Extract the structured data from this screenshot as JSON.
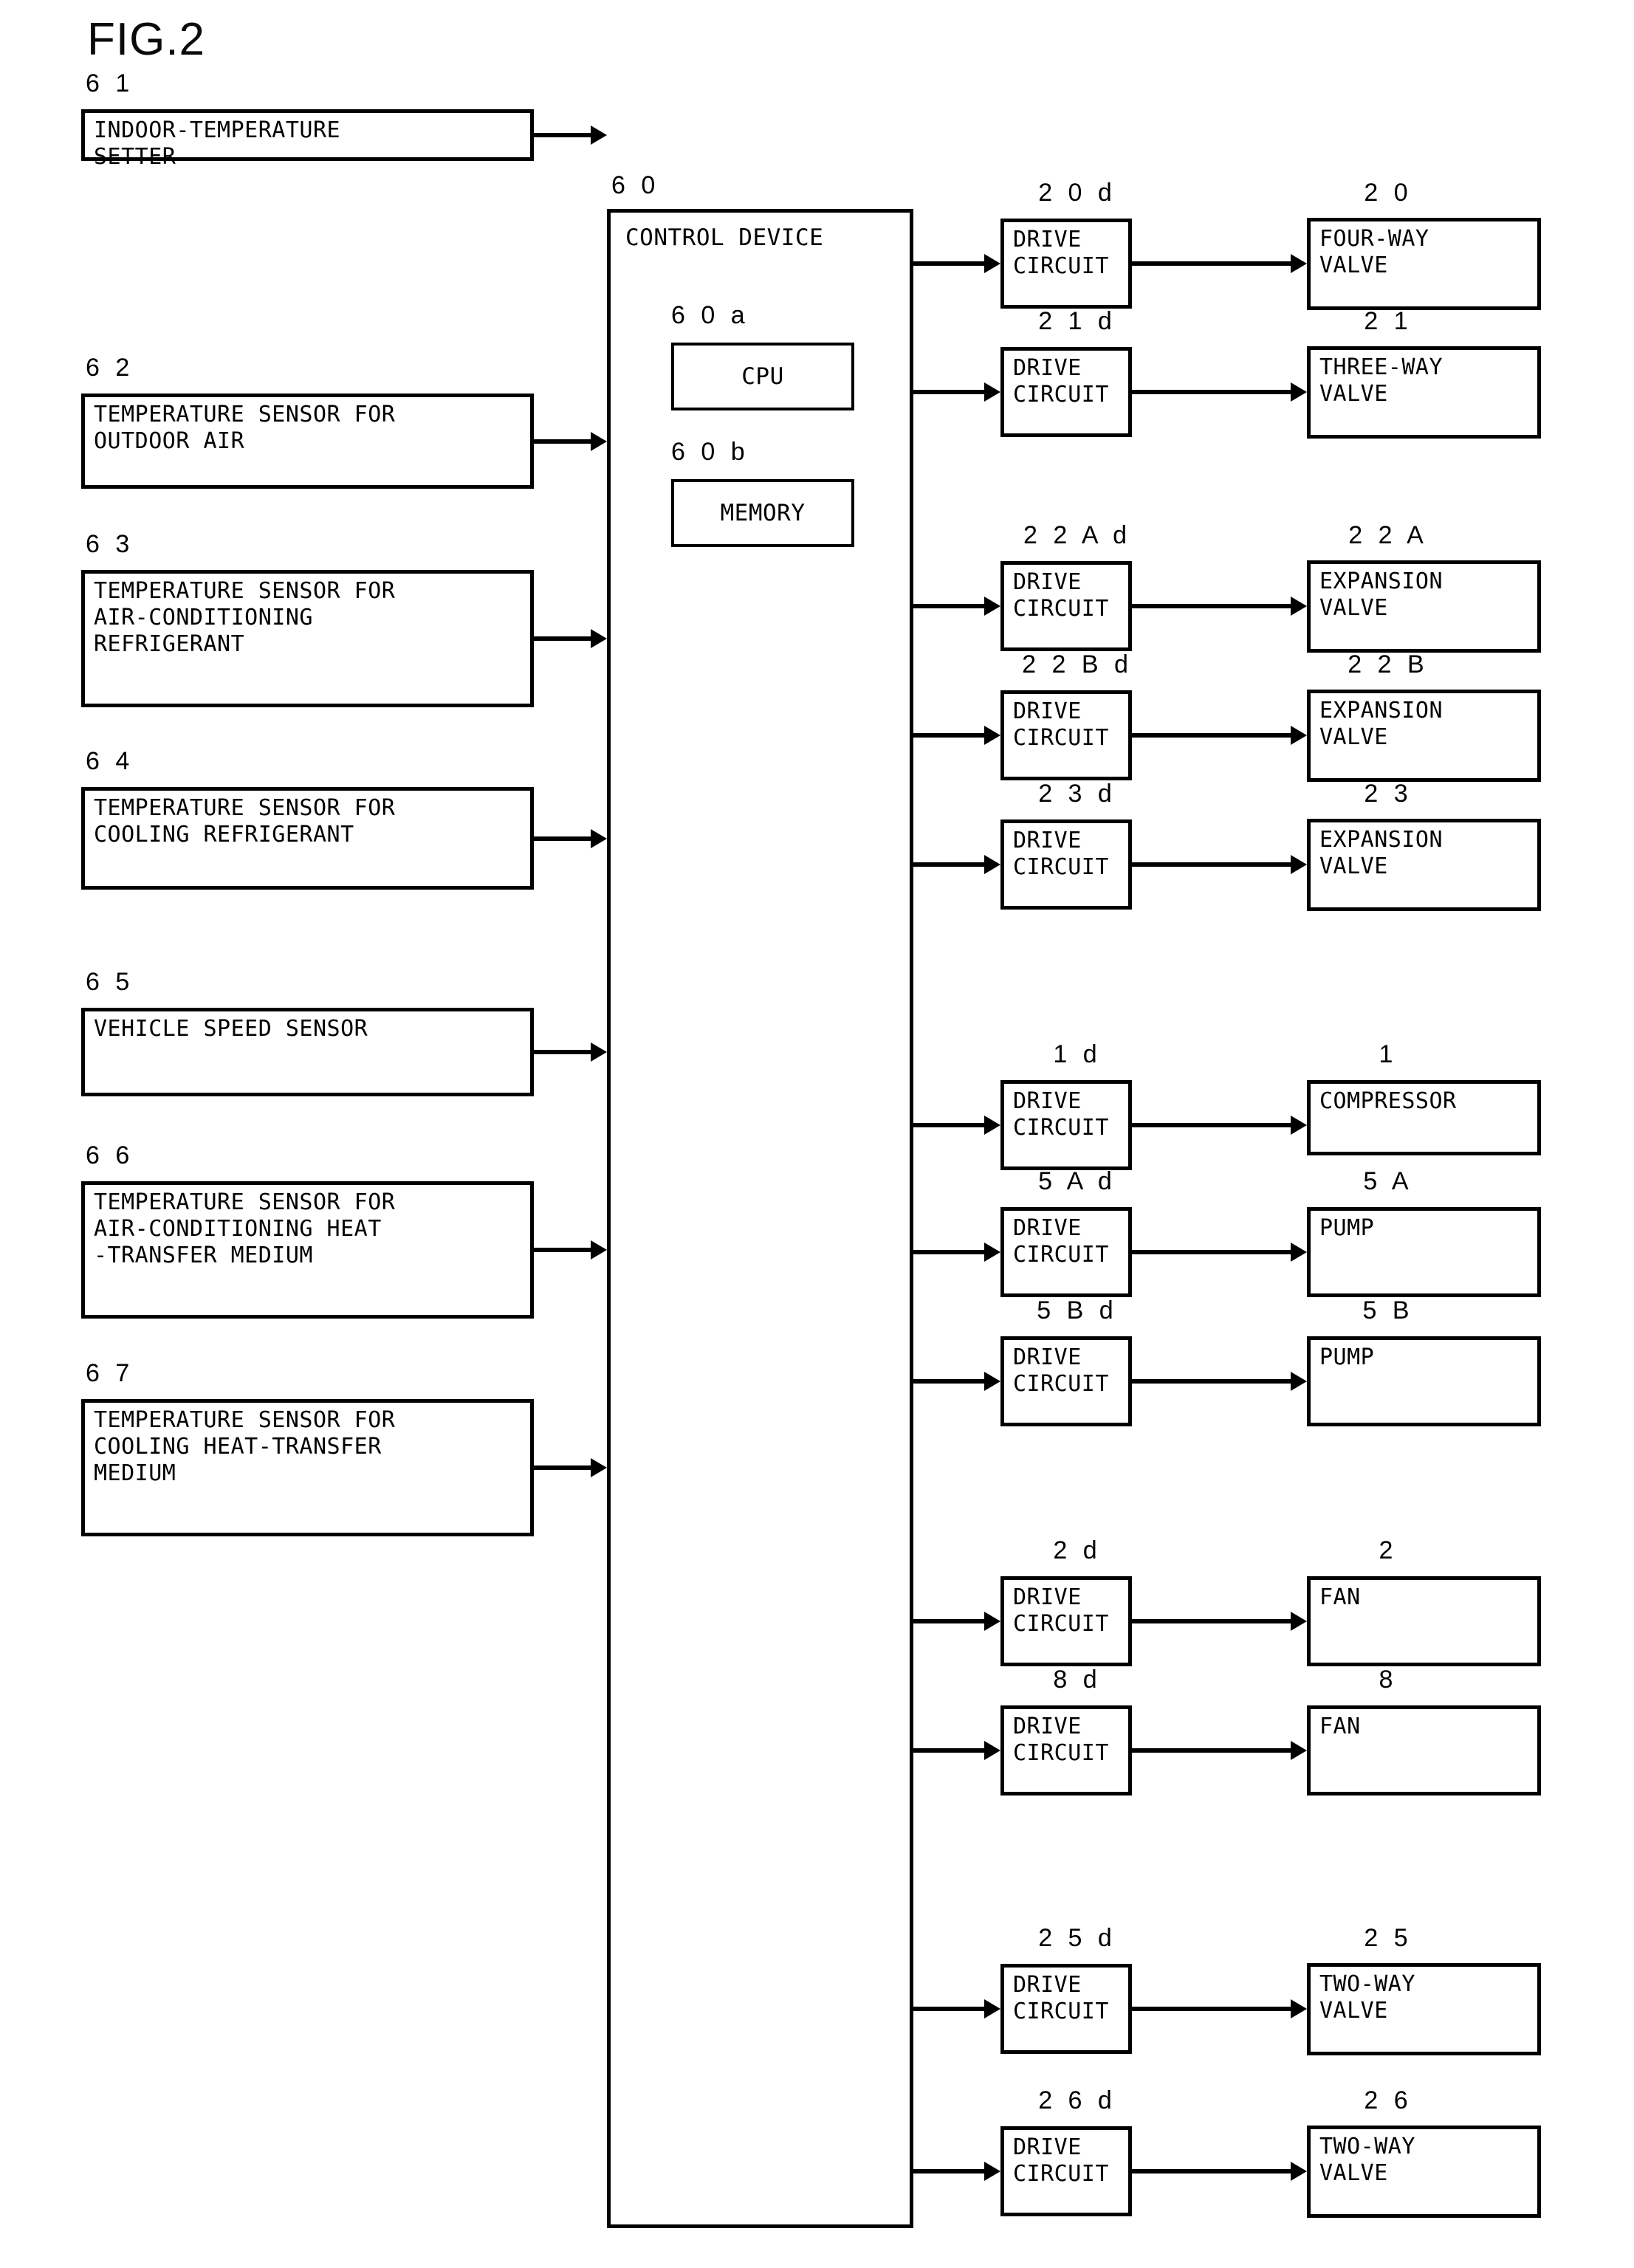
{
  "figure": {
    "title": "FIG.2"
  },
  "inputs": [
    {
      "ref": "6 1",
      "lines": [
        "INDOOR-TEMPERATURE",
        "SETTER"
      ]
    },
    {
      "ref": "6 2",
      "lines": [
        "TEMPERATURE SENSOR FOR",
        "OUTDOOR AIR"
      ]
    },
    {
      "ref": "6 3",
      "lines": [
        "TEMPERATURE SENSOR FOR",
        "AIR-CONDITIONING",
        "REFRIGERANT"
      ]
    },
    {
      "ref": "6 4",
      "lines": [
        "TEMPERATURE SENSOR FOR",
        "COOLING REFRIGERANT"
      ]
    },
    {
      "ref": "6 5",
      "lines": [
        "VEHICLE SPEED SENSOR"
      ]
    },
    {
      "ref": "6 6",
      "lines": [
        "TEMPERATURE SENSOR FOR",
        "AIR-CONDITIONING HEAT",
        "-TRANSFER MEDIUM"
      ]
    },
    {
      "ref": "6 7",
      "lines": [
        "TEMPERATURE SENSOR FOR",
        "COOLING HEAT-TRANSFER",
        "MEDIUM"
      ]
    }
  ],
  "control": {
    "ref": "6 0",
    "title": "CONTROL DEVICE",
    "cpu": {
      "ref": "6 0 a",
      "label": "CPU"
    },
    "memory": {
      "ref": "6 0 b",
      "label": "MEMORY"
    }
  },
  "outputs": [
    {
      "drive_ref": "2 0 d",
      "drive_lines": [
        "DRIVE",
        "CIRCUIT"
      ],
      "target_ref": "2 0",
      "target_lines": [
        "FOUR-WAY",
        "VALVE"
      ]
    },
    {
      "drive_ref": "2 1 d",
      "drive_lines": [
        "DRIVE",
        "CIRCUIT"
      ],
      "target_ref": "2 1",
      "target_lines": [
        "THREE-WAY",
        "VALVE"
      ]
    },
    {
      "drive_ref": "2 2 A d",
      "drive_lines": [
        "DRIVE",
        "CIRCUIT"
      ],
      "target_ref": "2 2 A",
      "target_lines": [
        "EXPANSION",
        "VALVE"
      ]
    },
    {
      "drive_ref": "2 2 B d",
      "drive_lines": [
        "DRIVE",
        "CIRCUIT"
      ],
      "target_ref": "2 2 B",
      "target_lines": [
        "EXPANSION",
        "VALVE"
      ]
    },
    {
      "drive_ref": "2 3 d",
      "drive_lines": [
        "DRIVE",
        "CIRCUIT"
      ],
      "target_ref": "2 3",
      "target_lines": [
        "EXPANSION",
        "VALVE"
      ]
    },
    {
      "drive_ref": "1 d",
      "drive_lines": [
        "DRIVE",
        "CIRCUIT"
      ],
      "target_ref": "1",
      "target_lines": [
        "COMPRESSOR"
      ]
    },
    {
      "drive_ref": "5 A d",
      "drive_lines": [
        "DRIVE",
        "CIRCUIT"
      ],
      "target_ref": "5 A",
      "target_lines": [
        "PUMP"
      ]
    },
    {
      "drive_ref": "5 B d",
      "drive_lines": [
        "DRIVE",
        "CIRCUIT"
      ],
      "target_ref": "5 B",
      "target_lines": [
        "PUMP"
      ]
    },
    {
      "drive_ref": "2 d",
      "drive_lines": [
        "DRIVE",
        "CIRCUIT"
      ],
      "target_ref": "2",
      "target_lines": [
        "FAN"
      ]
    },
    {
      "drive_ref": "8 d",
      "drive_lines": [
        "DRIVE",
        "CIRCUIT"
      ],
      "target_ref": "8",
      "target_lines": [
        "FAN"
      ]
    },
    {
      "drive_ref": "2 5 d",
      "drive_lines": [
        "DRIVE",
        "CIRCUIT"
      ],
      "target_ref": "2 5",
      "target_lines": [
        "TWO-WAY",
        "VALVE"
      ]
    },
    {
      "drive_ref": "2 6 d",
      "drive_lines": [
        "DRIVE",
        "CIRCUIT"
      ],
      "target_ref": "2 6",
      "target_lines": [
        "TWO-WAY",
        "VALVE"
      ]
    }
  ],
  "colors": {
    "line": "#000000",
    "background": "#ffffff"
  }
}
